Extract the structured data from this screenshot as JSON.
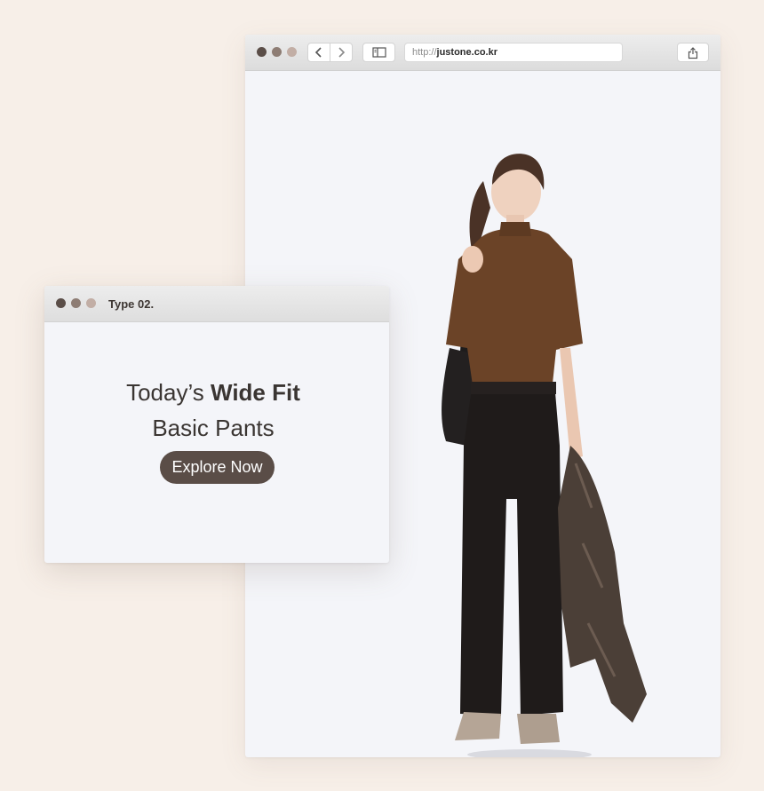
{
  "browser": {
    "url_scheme": "http://",
    "url_host": "justone.co.kr",
    "traffic_light_colors": [
      "#5b4e48",
      "#8e7d74",
      "#c2aea5"
    ]
  },
  "icons": {
    "back": "chevron-left-icon",
    "forward": "chevron-right-icon",
    "sidebar": "sidebar-icon",
    "share": "share-icon"
  },
  "card": {
    "title": "Type 02.",
    "headline_pre": "Today’s ",
    "headline_bold": "Wide Fit",
    "headline_line2": "Basic Pants",
    "cta_label": "Explore Now"
  },
  "colors": {
    "page_background": "#f7efe8",
    "window_background": "#f4f5f9",
    "cta_background": "#5a4d47",
    "top_color": "#6b4327",
    "pants_color": "#1f1b1a"
  }
}
